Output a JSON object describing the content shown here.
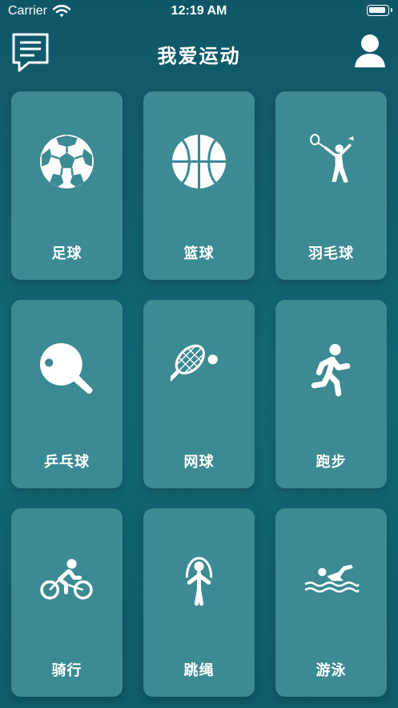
{
  "status_bar": {
    "carrier": "Carrier",
    "time": "12:19 AM",
    "icons": [
      "wifi-icon",
      "battery-icon"
    ]
  },
  "nav": {
    "title": "我爱运动",
    "left_icon": "message-list-icon",
    "right_icon": "user-profile-icon"
  },
  "sports": [
    {
      "label": "足球",
      "icon": "soccer-ball-icon"
    },
    {
      "label": "篮球",
      "icon": "basketball-icon"
    },
    {
      "label": "羽毛球",
      "icon": "badminton-player-icon"
    },
    {
      "label": "乒乓球",
      "icon": "ping-pong-icon"
    },
    {
      "label": "网球",
      "icon": "tennis-racket-icon"
    },
    {
      "label": "跑步",
      "icon": "running-icon"
    },
    {
      "label": "骑行",
      "icon": "cycling-icon"
    },
    {
      "label": "跳绳",
      "icon": "jump-rope-icon"
    },
    {
      "label": "游泳",
      "icon": "swimming-icon"
    }
  ],
  "colors": {
    "background": "#136775",
    "card": "#3c8a93",
    "text": "#ffffff"
  }
}
